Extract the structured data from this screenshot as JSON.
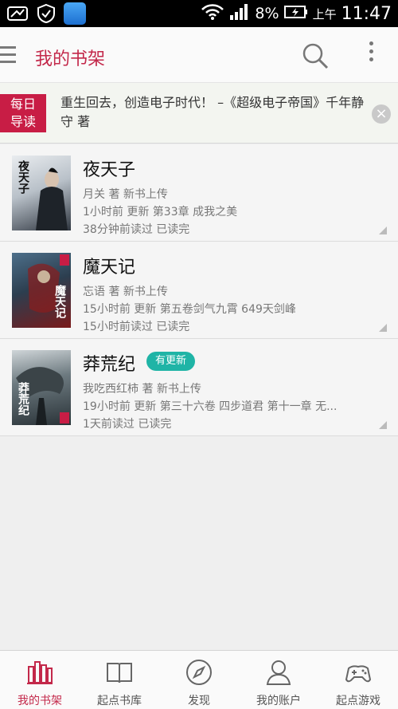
{
  "status_bar": {
    "battery": "8%",
    "period": "上午",
    "time": "11:47"
  },
  "header": {
    "title": "我的书架",
    "icons": [
      "menu-icon",
      "search-icon",
      "more-icon"
    ]
  },
  "banner": {
    "badge": "每日\n导读",
    "badge_line1": "每日",
    "badge_line2": "导读",
    "text": "重生回去，创造电子时代！ –《超级电子帝国》千年静守 著"
  },
  "books": [
    {
      "title": "夜天子",
      "cover_text": "夜天子",
      "author_line": "月关 著  新书上传",
      "update_line": "1小时前  更新  第33章 成我之美",
      "read_line": "38分钟前读过  已读完",
      "badge": ""
    },
    {
      "title": "魔天记",
      "cover_text": "魔天记",
      "author_line": "忘语 著  新书上传",
      "update_line": "15小时前  更新  第五卷剑气九霄 649天剑峰",
      "read_line": "15小时前读过  已读完",
      "badge": ""
    },
    {
      "title": "莽荒纪",
      "cover_text": "莽荒纪",
      "author_line": "我吃西红柿 著  新书上传",
      "update_line": "19小时前  更新  第三十六卷 四步道君 第十一章 无...",
      "read_line": "1天前读过  已读完",
      "badge": "有更新"
    }
  ],
  "bottom_nav": [
    {
      "label": "我的书架",
      "icon": "bookshelf-icon",
      "active": true
    },
    {
      "label": "起点书库",
      "icon": "open-book-icon",
      "active": false
    },
    {
      "label": "发现",
      "icon": "compass-icon",
      "active": false
    },
    {
      "label": "我的账户",
      "icon": "user-icon",
      "active": false
    },
    {
      "label": "起点游戏",
      "icon": "gamepad-icon",
      "active": false
    }
  ],
  "colors": {
    "accent": "#c3284a",
    "badge_red": "#c81d45",
    "update_teal": "#1fb4a6"
  }
}
